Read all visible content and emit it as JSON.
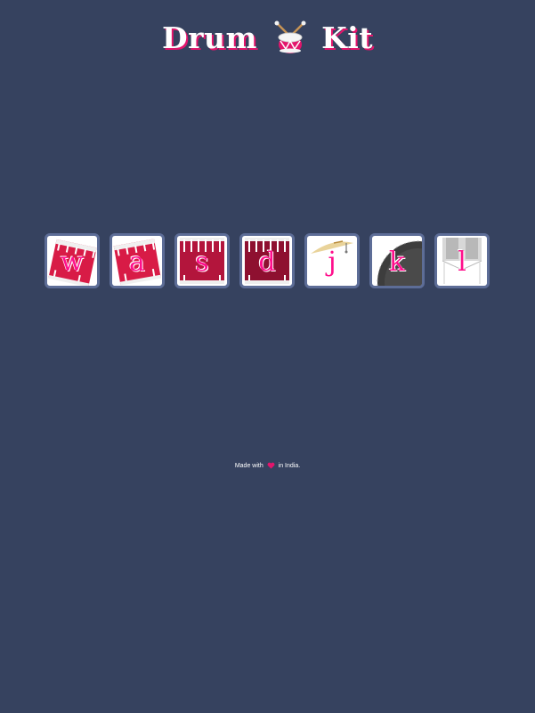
{
  "header": {
    "title_left": "Drum",
    "title_right": "Kit",
    "logo_icon": "drum-icon"
  },
  "drum_keys": [
    {
      "key": "w",
      "image": "tom-1-icon",
      "color": "#d81b46"
    },
    {
      "key": "a",
      "image": "tom-2-icon",
      "color": "#d81b46"
    },
    {
      "key": "s",
      "image": "tom-3-icon",
      "color": "#b3153c"
    },
    {
      "key": "d",
      "image": "tom-4-icon",
      "color": "#8e1030"
    },
    {
      "key": "j",
      "image": "snare-icon",
      "color": "#e9d39a"
    },
    {
      "key": "k",
      "image": "crash-icon",
      "color": "#3d3d3d"
    },
    {
      "key": "l",
      "image": "kick-icon",
      "color": "#b8b8b8"
    }
  ],
  "footer": {
    "made_with": "Made with",
    "in_india": "in India.",
    "heart_icon": "heart-icon",
    "heart_color": "#e3156c"
  },
  "colors": {
    "background": "#36425f",
    "key_border": "#5d6d97",
    "letter": "#ff0f8c",
    "title_shadow": "#e3156c"
  }
}
